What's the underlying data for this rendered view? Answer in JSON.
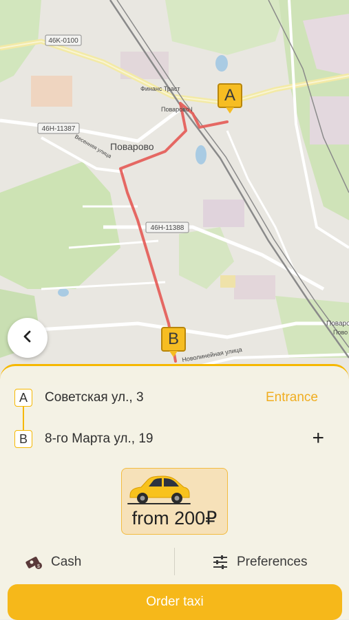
{
  "map": {
    "roads": [
      "46K-0100",
      "46H-11387",
      "46H-11388"
    ],
    "places": [
      "Поварово",
      "Финанс Траст",
      "Поварово I"
    ],
    "streets": [
      "Весенняя улица",
      "Новолинейная улица"
    ],
    "edge_labels": [
      "Поваро",
      "Пово"
    ],
    "marker_a": "A",
    "marker_b": "B"
  },
  "nav": {
    "back_icon": "chevron-left-icon"
  },
  "route": {
    "from": {
      "letter": "A",
      "address": "Советская ул., 3",
      "action": "Entrance"
    },
    "to": {
      "letter": "B",
      "address": "8-го Марта ул., 19",
      "action": "+"
    }
  },
  "tariff": {
    "price": "from 200₽",
    "icon": "car-icon"
  },
  "options": {
    "payment": {
      "label": "Cash",
      "icon": "cash-icon"
    },
    "preferences": {
      "label": "Preferences",
      "icon": "sliders-icon"
    }
  },
  "order_button": "Order taxi",
  "colors": {
    "accent": "#f6b81a",
    "route": "#e45a55",
    "entrance": "#f0ad20"
  }
}
